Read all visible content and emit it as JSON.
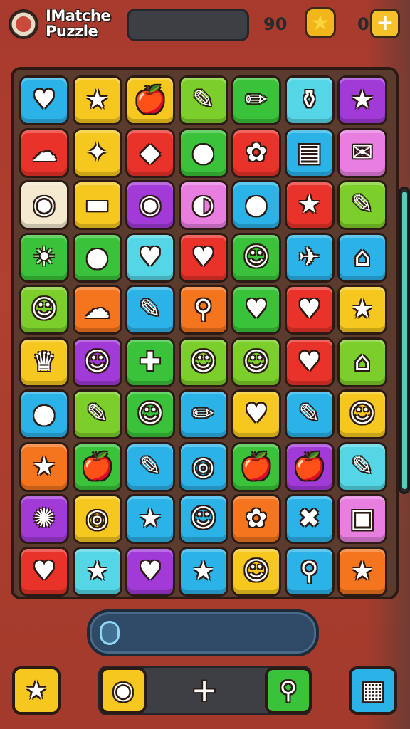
{
  "header": {
    "title": "IMatche Puzzle",
    "score": "90",
    "coins": "0",
    "star_icon": "star-icon",
    "plus_label": "+"
  },
  "board": {
    "rows": [
      [
        {
          "c": "#2bb3e8",
          "i": "♥",
          "n": "heart"
        },
        {
          "c": "#f6c81f",
          "i": "★",
          "n": "star"
        },
        {
          "c": "#f6c81f",
          "i": "🍎",
          "n": "apple-box"
        },
        {
          "c": "#7ccf2a",
          "i": "✎",
          "n": "carrot"
        },
        {
          "c": "#3ac23a",
          "i": "✏",
          "n": "marker"
        },
        {
          "c": "#55d6e6",
          "i": "⚱",
          "n": "bottle"
        },
        {
          "c": "#a23ad8",
          "i": "★",
          "n": "star"
        }
      ],
      [
        {
          "c": "#e8322a",
          "i": "☁",
          "n": "cloud"
        },
        {
          "c": "#f6c81f",
          "i": "✦",
          "n": "star-face"
        },
        {
          "c": "#e8322a",
          "i": "◆",
          "n": "gem"
        },
        {
          "c": "#3ac23a",
          "i": "●",
          "n": "balloon"
        },
        {
          "c": "#e8322a",
          "i": "✿",
          "n": "flower"
        },
        {
          "c": "#2bb3e8",
          "i": "▤",
          "n": "cake"
        },
        {
          "c": "#e77ee0",
          "i": "✉",
          "n": "paper"
        }
      ],
      [
        {
          "c": "#f5ead0",
          "i": "◉",
          "n": "camera"
        },
        {
          "c": "#f6c81f",
          "i": "▬",
          "n": "hat"
        },
        {
          "c": "#a23ad8",
          "i": "◉",
          "n": "camera"
        },
        {
          "c": "#e77ee0",
          "i": "◐",
          "n": "tube"
        },
        {
          "c": "#2bb3e8",
          "i": "●",
          "n": "bulb"
        },
        {
          "c": "#e8322a",
          "i": "★",
          "n": "star"
        },
        {
          "c": "#7ccf2a",
          "i": "✎",
          "n": "carrot"
        }
      ],
      [
        {
          "c": "#3ac23a",
          "i": "☀",
          "n": "sun"
        },
        {
          "c": "#3ac23a",
          "i": "●",
          "n": "pear"
        },
        {
          "c": "#55d6e6",
          "i": "♥",
          "n": "heart"
        },
        {
          "c": "#e8322a",
          "i": "♥",
          "n": "heart"
        },
        {
          "c": "#3ac23a",
          "i": "☺",
          "n": "devil"
        },
        {
          "c": "#2bb3e8",
          "i": "✈",
          "n": "plane"
        },
        {
          "c": "#2bb3e8",
          "i": "⌂",
          "n": "house"
        }
      ],
      [
        {
          "c": "#7ccf2a",
          "i": "☺",
          "n": "cat"
        },
        {
          "c": "#f5741e",
          "i": "☁",
          "n": "cloud"
        },
        {
          "c": "#2bb3e8",
          "i": "✎",
          "n": "leaf"
        },
        {
          "c": "#f5741e",
          "i": "⚲",
          "n": "pin"
        },
        {
          "c": "#3ac23a",
          "i": "♥",
          "n": "heart"
        },
        {
          "c": "#e8322a",
          "i": "♥",
          "n": "heart"
        },
        {
          "c": "#f6c81f",
          "i": "★",
          "n": "star"
        }
      ],
      [
        {
          "c": "#f6c81f",
          "i": "♛",
          "n": "crown"
        },
        {
          "c": "#a23ad8",
          "i": "☺",
          "n": "cat"
        },
        {
          "c": "#3ac23a",
          "i": "✚",
          "n": "splat"
        },
        {
          "c": "#7ccf2a",
          "i": "☺",
          "n": "cat"
        },
        {
          "c": "#7ccf2a",
          "i": "☺",
          "n": "cat"
        },
        {
          "c": "#e8322a",
          "i": "♥",
          "n": "heart"
        },
        {
          "c": "#7ccf2a",
          "i": "⌂",
          "n": "house"
        }
      ],
      [
        {
          "c": "#2bb3e8",
          "i": "●",
          "n": "lollipop"
        },
        {
          "c": "#7ccf2a",
          "i": "✎",
          "n": "corn"
        },
        {
          "c": "#3ac23a",
          "i": "☺",
          "n": "devil"
        },
        {
          "c": "#2bb3e8",
          "i": "✏",
          "n": "pencil"
        },
        {
          "c": "#f6c81f",
          "i": "♥",
          "n": "heart"
        },
        {
          "c": "#2bb3e8",
          "i": "✎",
          "n": "corn"
        },
        {
          "c": "#f6c81f",
          "i": "☺",
          "n": "bear"
        }
      ],
      [
        {
          "c": "#f5741e",
          "i": "★",
          "n": "star"
        },
        {
          "c": "#3ac23a",
          "i": "🍎",
          "n": "apple"
        },
        {
          "c": "#2bb3e8",
          "i": "✎",
          "n": "corn"
        },
        {
          "c": "#2bb3e8",
          "i": "◎",
          "n": "ring"
        },
        {
          "c": "#3ac23a",
          "i": "🍎",
          "n": "apple"
        },
        {
          "c": "#a23ad8",
          "i": "🍎",
          "n": "apple"
        },
        {
          "c": "#55d6e6",
          "i": "✎",
          "n": "carrot"
        }
      ],
      [
        {
          "c": "#a23ad8",
          "i": "✺",
          "n": "gear"
        },
        {
          "c": "#f6c81f",
          "i": "◎",
          "n": "ring"
        },
        {
          "c": "#2bb3e8",
          "i": "★",
          "n": "star"
        },
        {
          "c": "#2bb3e8",
          "i": "☺",
          "n": "cat"
        },
        {
          "c": "#f5741e",
          "i": "✿",
          "n": "flower"
        },
        {
          "c": "#2bb3e8",
          "i": "✖",
          "n": "cross"
        },
        {
          "c": "#e77ee0",
          "i": "▣",
          "n": "tablet"
        }
      ],
      [
        {
          "c": "#e8322a",
          "i": "♥",
          "n": "heart"
        },
        {
          "c": "#55d6e6",
          "i": "★",
          "n": "star"
        },
        {
          "c": "#a23ad8",
          "i": "♥",
          "n": "heart"
        },
        {
          "c": "#2bb3e8",
          "i": "★",
          "n": "star"
        },
        {
          "c": "#f6c81f",
          "i": "☺",
          "n": "lion"
        },
        {
          "c": "#2bb3e8",
          "i": "⚲",
          "n": "key"
        },
        {
          "c": "#f5741e",
          "i": "★",
          "n": "star"
        }
      ]
    ]
  },
  "progress": {
    "fill": 0.05
  },
  "bottom": {
    "left_icon": "★",
    "camera_icon": "◉",
    "plus_icon": "+",
    "search_icon": "⚲",
    "grid_icon": "▦"
  }
}
